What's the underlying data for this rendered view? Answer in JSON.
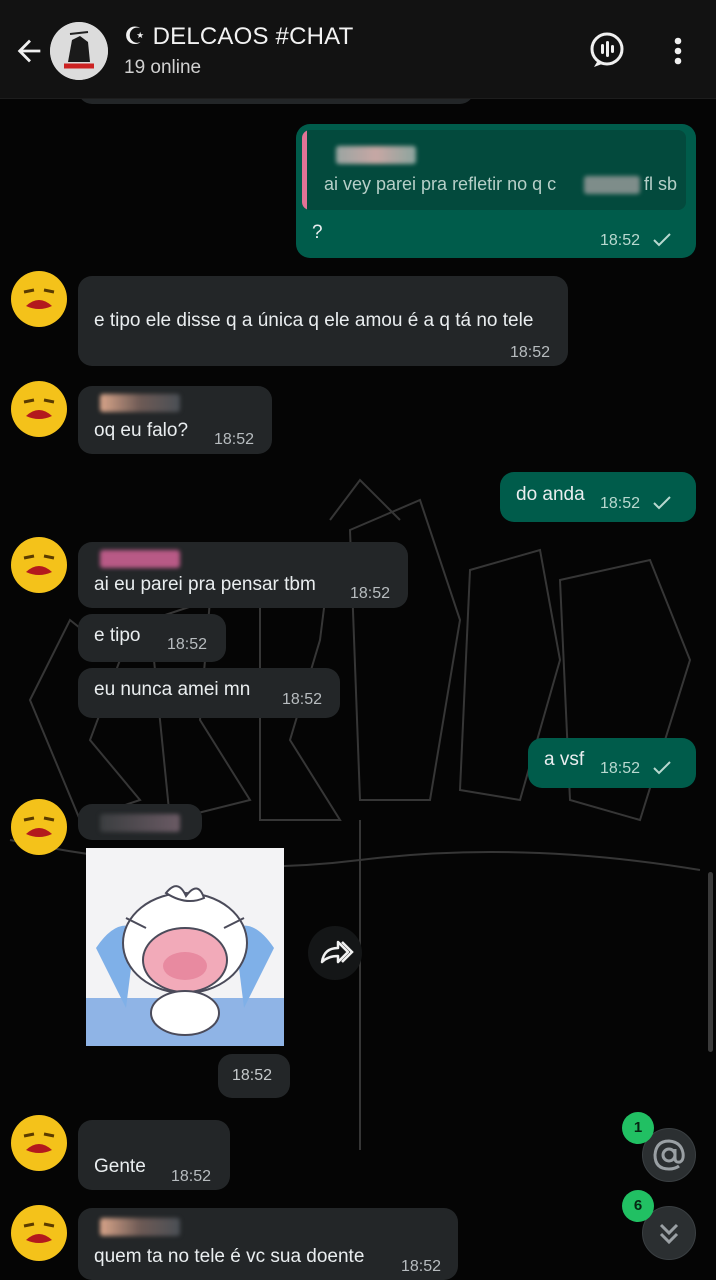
{
  "header": {
    "title": "☪ DELCAOS #CHAT",
    "subtitle": "19 online"
  },
  "messages": {
    "m1": {
      "quote_text": "ai vey parei pra refletir no q c",
      "quote_tail": "fl sb",
      "text": "?",
      "time": "18:52"
    },
    "m2": {
      "text": "e tipo ele disse q a única q ele amou é a q tá no tele",
      "time": "18:52"
    },
    "m3": {
      "text": "oq eu falo?",
      "time": "18:52"
    },
    "m4": {
      "text": "do anda",
      "time": "18:52"
    },
    "m5": {
      "text": "ai eu parei pra pensar tbm",
      "time": "18:52"
    },
    "m6": {
      "text": "e tipo",
      "time": "18:52"
    },
    "m7": {
      "text": "eu nunca amei mn",
      "time": "18:52"
    },
    "m8": {
      "text": "a vsf",
      "time": "18:52"
    },
    "m9": {
      "time": "18:52"
    },
    "m10": {
      "text": "Gente",
      "time": "18:52"
    },
    "m11": {
      "text": "quem ta no tele é vc sua doente",
      "time": "18:52"
    }
  },
  "fabs": {
    "mentions_count": "1",
    "unread_count": "6"
  },
  "colors": {
    "incoming_bubble": "#232628",
    "outgoing_bubble": "#005c4b",
    "badge": "#21c063",
    "quote_bar": "#e27396"
  },
  "icons": [
    "back-arrow-icon",
    "voice-chat-icon",
    "more-vert-icon",
    "check-icon",
    "forward-icon",
    "at-icon",
    "double-chevron-down-icon"
  ]
}
